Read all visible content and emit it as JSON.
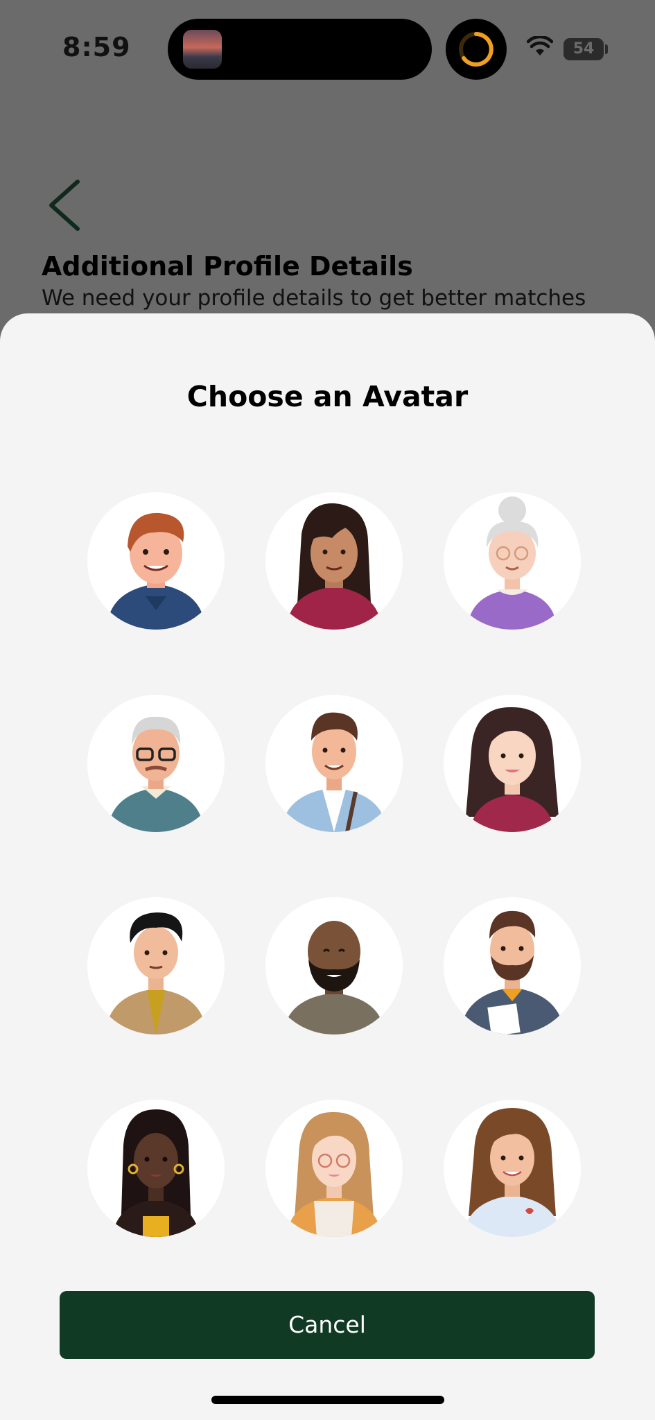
{
  "status_bar": {
    "time": "8:59",
    "battery_level": "54",
    "icons": [
      "wifi-icon",
      "battery-icon",
      "activity-ring-icon"
    ]
  },
  "page": {
    "title": "Additional Profile Details",
    "subtitle": "We need your profile details to get better matches",
    "back_icon": "chevron-left-icon"
  },
  "sheet": {
    "title": "Choose an Avatar",
    "avatars": [
      {
        "name": "man-red-hair-blue-shirt"
      },
      {
        "name": "woman-long-dark-hair-maroon-top"
      },
      {
        "name": "elderly-woman-purple-top"
      },
      {
        "name": "elderly-man-glasses-teal-shirt"
      },
      {
        "name": "young-man-denim-jacket"
      },
      {
        "name": "woman-long-hair-red-top"
      },
      {
        "name": "man-black-hair-tan-jacket"
      },
      {
        "name": "bald-man-beard-grey-shirt"
      },
      {
        "name": "man-beard-hoodie"
      },
      {
        "name": "woman-braids-hoop-earrings"
      },
      {
        "name": "woman-glasses-orange-cardigan"
      },
      {
        "name": "woman-long-brown-hair-white-top"
      }
    ],
    "cancel_label": "Cancel"
  },
  "colors": {
    "overlay": "#6b6b6b",
    "sheet_background": "#f4f4f4",
    "button": "#113a24",
    "button_text": "#ffffff",
    "ring_accent": "#f0a020"
  }
}
